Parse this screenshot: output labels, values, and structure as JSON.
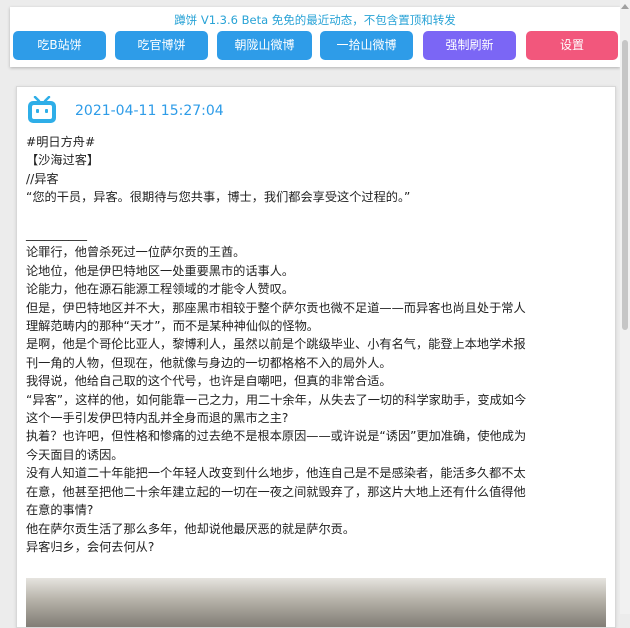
{
  "header": {
    "title": "蹲饼 V1.3.6 Beta 免免的最近动态，不包含置顶和转发",
    "buttons": [
      {
        "label": "吃B站饼",
        "color": "#2e9ce8"
      },
      {
        "label": "吃官博饼",
        "color": "#2e9ce8"
      },
      {
        "label": "朝陇山微博",
        "color": "#2e9ce8"
      },
      {
        "label": "一拾山微博",
        "color": "#2e9ce8"
      },
      {
        "label": "强制刷新",
        "color": "#7b66f5"
      },
      {
        "label": "设置",
        "color": "#f2577c"
      }
    ]
  },
  "post": {
    "source_icon": "bilibili-tv-icon",
    "timestamp": "2021-04-11 15:27:04",
    "lines": [
      "#明日方舟#",
      "【沙海过客】",
      "//异客",
      "“您的干员，异客。很期待与您共事，博士，我们都会享受这个过程的。”",
      "",
      "__________",
      "论罪行，他曾杀死过一位萨尔贡的王酋。",
      "论地位，他是伊巴特地区一处重要黑市的话事人。",
      "论能力，他在源石能源工程领域的才能令人赞叹。",
      "但是，伊巴特地区并不大，那座黑市相较于整个萨尔贡也微不足道——而异客也尚且处于常人",
      "理解范畴内的那种“天才”，而不是某种神仙似的怪物。",
      "是啊，他是个哥伦比亚人，黎博利人，虽然以前是个跳级毕业、小有名气，能登上本地学术报",
      "刊一角的人物，但现在，他就像与身边的一切都格格不入的局外人。",
      "我得说，他给自己取的这个代号，也许是自嘲吧，但真的非常合适。",
      "“异客”，这样的他，如何能靠一己之力，用二十余年，从失去了一切的科学家助手，变成如今",
      "这个一手引发伊巴特内乱并全身而退的黑市之主?",
      "执着？也许吧，但性格和惨痛的过去绝不是根本原因——或许说是“诱因”更加准确，使他成为",
      "今天面目的诱因。",
      "没有人知道二十年能把一个年轻人改变到什么地步，他连自己是不是感染者，能活多久都不太",
      "在意，他甚至把他二十余年建立起的一切在一夜之间就毁弃了，那这片大地上还有什么值得他",
      "在意的事情?",
      "他在萨尔贡生活了那么多年，他却说他最厌恶的就是萨尔贡。",
      "异客归乡，会何去何从?"
    ]
  }
}
